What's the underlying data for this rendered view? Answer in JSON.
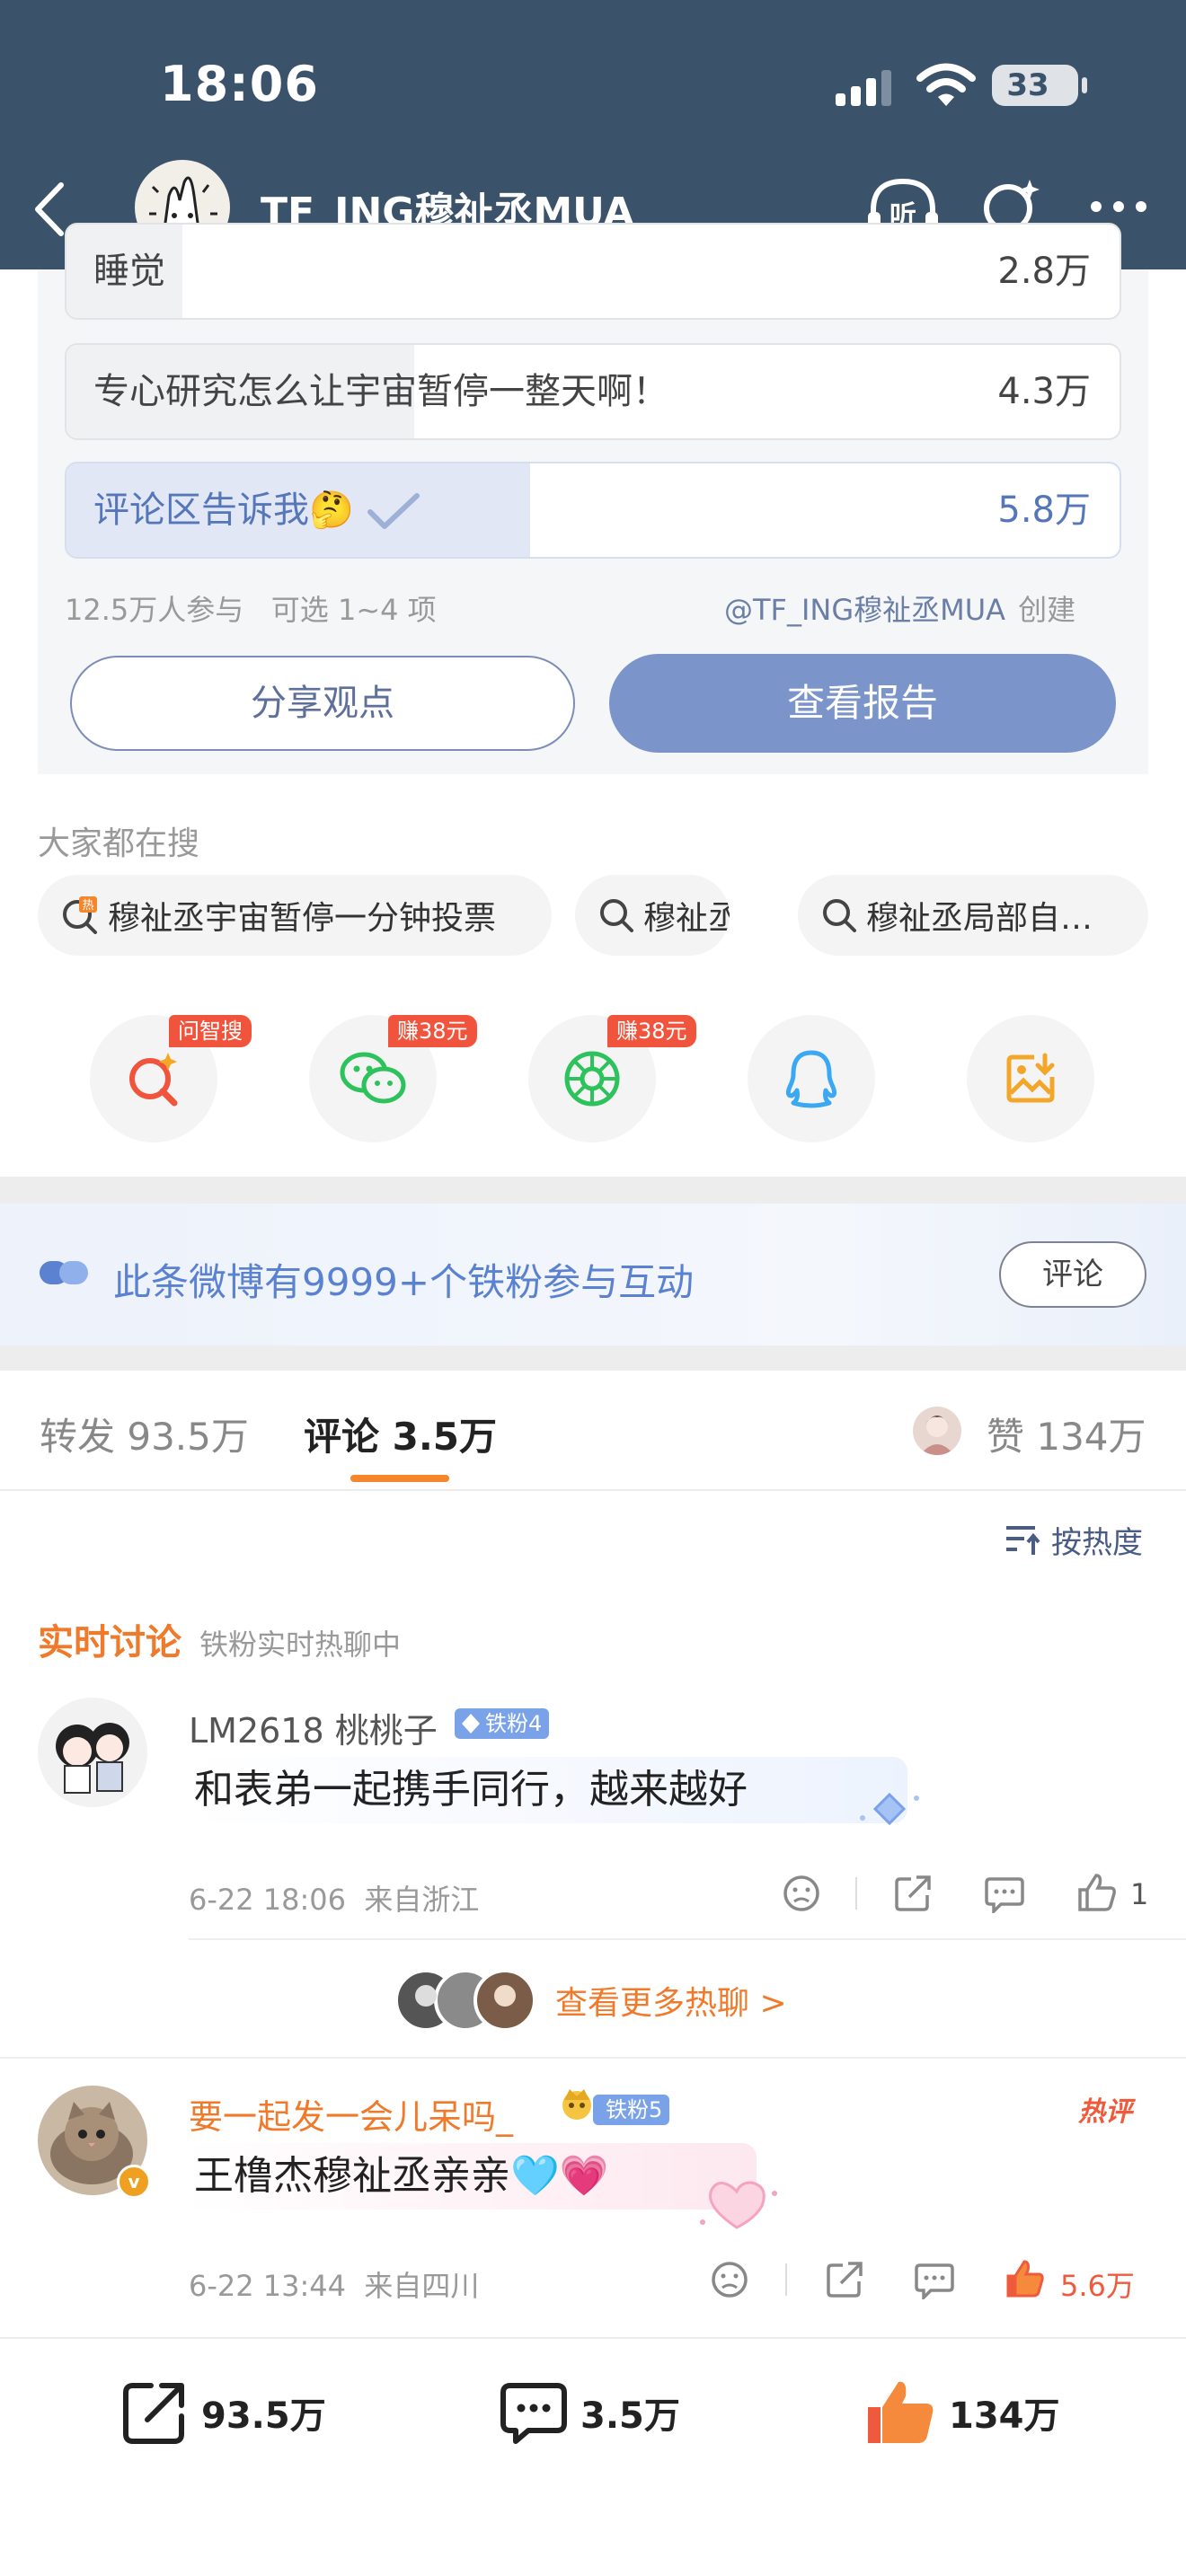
{
  "status_bar": {
    "time": "18:06",
    "battery": "33"
  },
  "header": {
    "title": "TF_ING穆祉丞MUA"
  },
  "poll": {
    "options": [
      {
        "label": "睡觉",
        "count": "2.8万",
        "share": 0.11
      },
      {
        "label": "专心研究怎么让宇宙暂停一整天啊！",
        "count": "4.3万",
        "share": 0.33
      },
      {
        "label": "评论区告诉我🤔",
        "count": "5.8万",
        "share": 0.44,
        "selected": true
      }
    ],
    "participants": "12.5万人参与",
    "choice_rule": "可选 1~4 项",
    "creator": "@TF_ING穆祉丞MUA",
    "creator_suffix": "创建",
    "share_label": "分享观点",
    "report_label": "查看报告"
  },
  "search": {
    "heading": "大家都在搜",
    "chips": [
      "穆祉丞宇宙暂停一分钟投票",
      "穆祉丞",
      "穆祉丞局部自…"
    ]
  },
  "share_targets": {
    "items": [
      {
        "icon": "ai-search-icon",
        "badge": "问智搜",
        "color": "#f0543c"
      },
      {
        "icon": "wechat-icon",
        "badge": "赚38元",
        "color": "#2dc25b"
      },
      {
        "icon": "moments-icon",
        "badge": "赚38元",
        "color": "#2dc25b"
      },
      {
        "icon": "qq-icon",
        "badge": "",
        "color": "#3aa8f2"
      },
      {
        "icon": "save-image-icon",
        "badge": "",
        "color": "#f2a72b"
      }
    ]
  },
  "fan_banner": {
    "text": "此条微博有9999+个铁粉参与互动",
    "button": "评论"
  },
  "tabs": {
    "repost": "转发 93.5万",
    "comment": "评论 3.5万",
    "likes": "赞 134万"
  },
  "sort": {
    "label": "按热度"
  },
  "live": {
    "title": "实时讨论",
    "subtitle": "铁粉实时热聊中"
  },
  "comments": [
    {
      "user": "LM2618 桃桃子",
      "level": "铁粉4",
      "text": "和表弟一起携手同行，越来越好",
      "time": "6-22 18:06",
      "location": "来自浙江",
      "likes": "1"
    },
    {
      "user": "要一起发一会儿呆吗_",
      "level": "铁粉5",
      "text": "王橹杰穆祉丞亲亲🩵💗",
      "time": "6-22 13:44",
      "location": "来自四川",
      "likes": "5.6万",
      "tag": "热评"
    }
  ],
  "more_hot": {
    "label": "查看更多热聊 >"
  },
  "bottom_bar": {
    "reposts": "93.5万",
    "comments": "3.5万",
    "likes": "134万"
  },
  "colors": {
    "header_bg": "#3b536a",
    "accent": "#f07a2b",
    "brand_blue": "#7b94c9"
  }
}
